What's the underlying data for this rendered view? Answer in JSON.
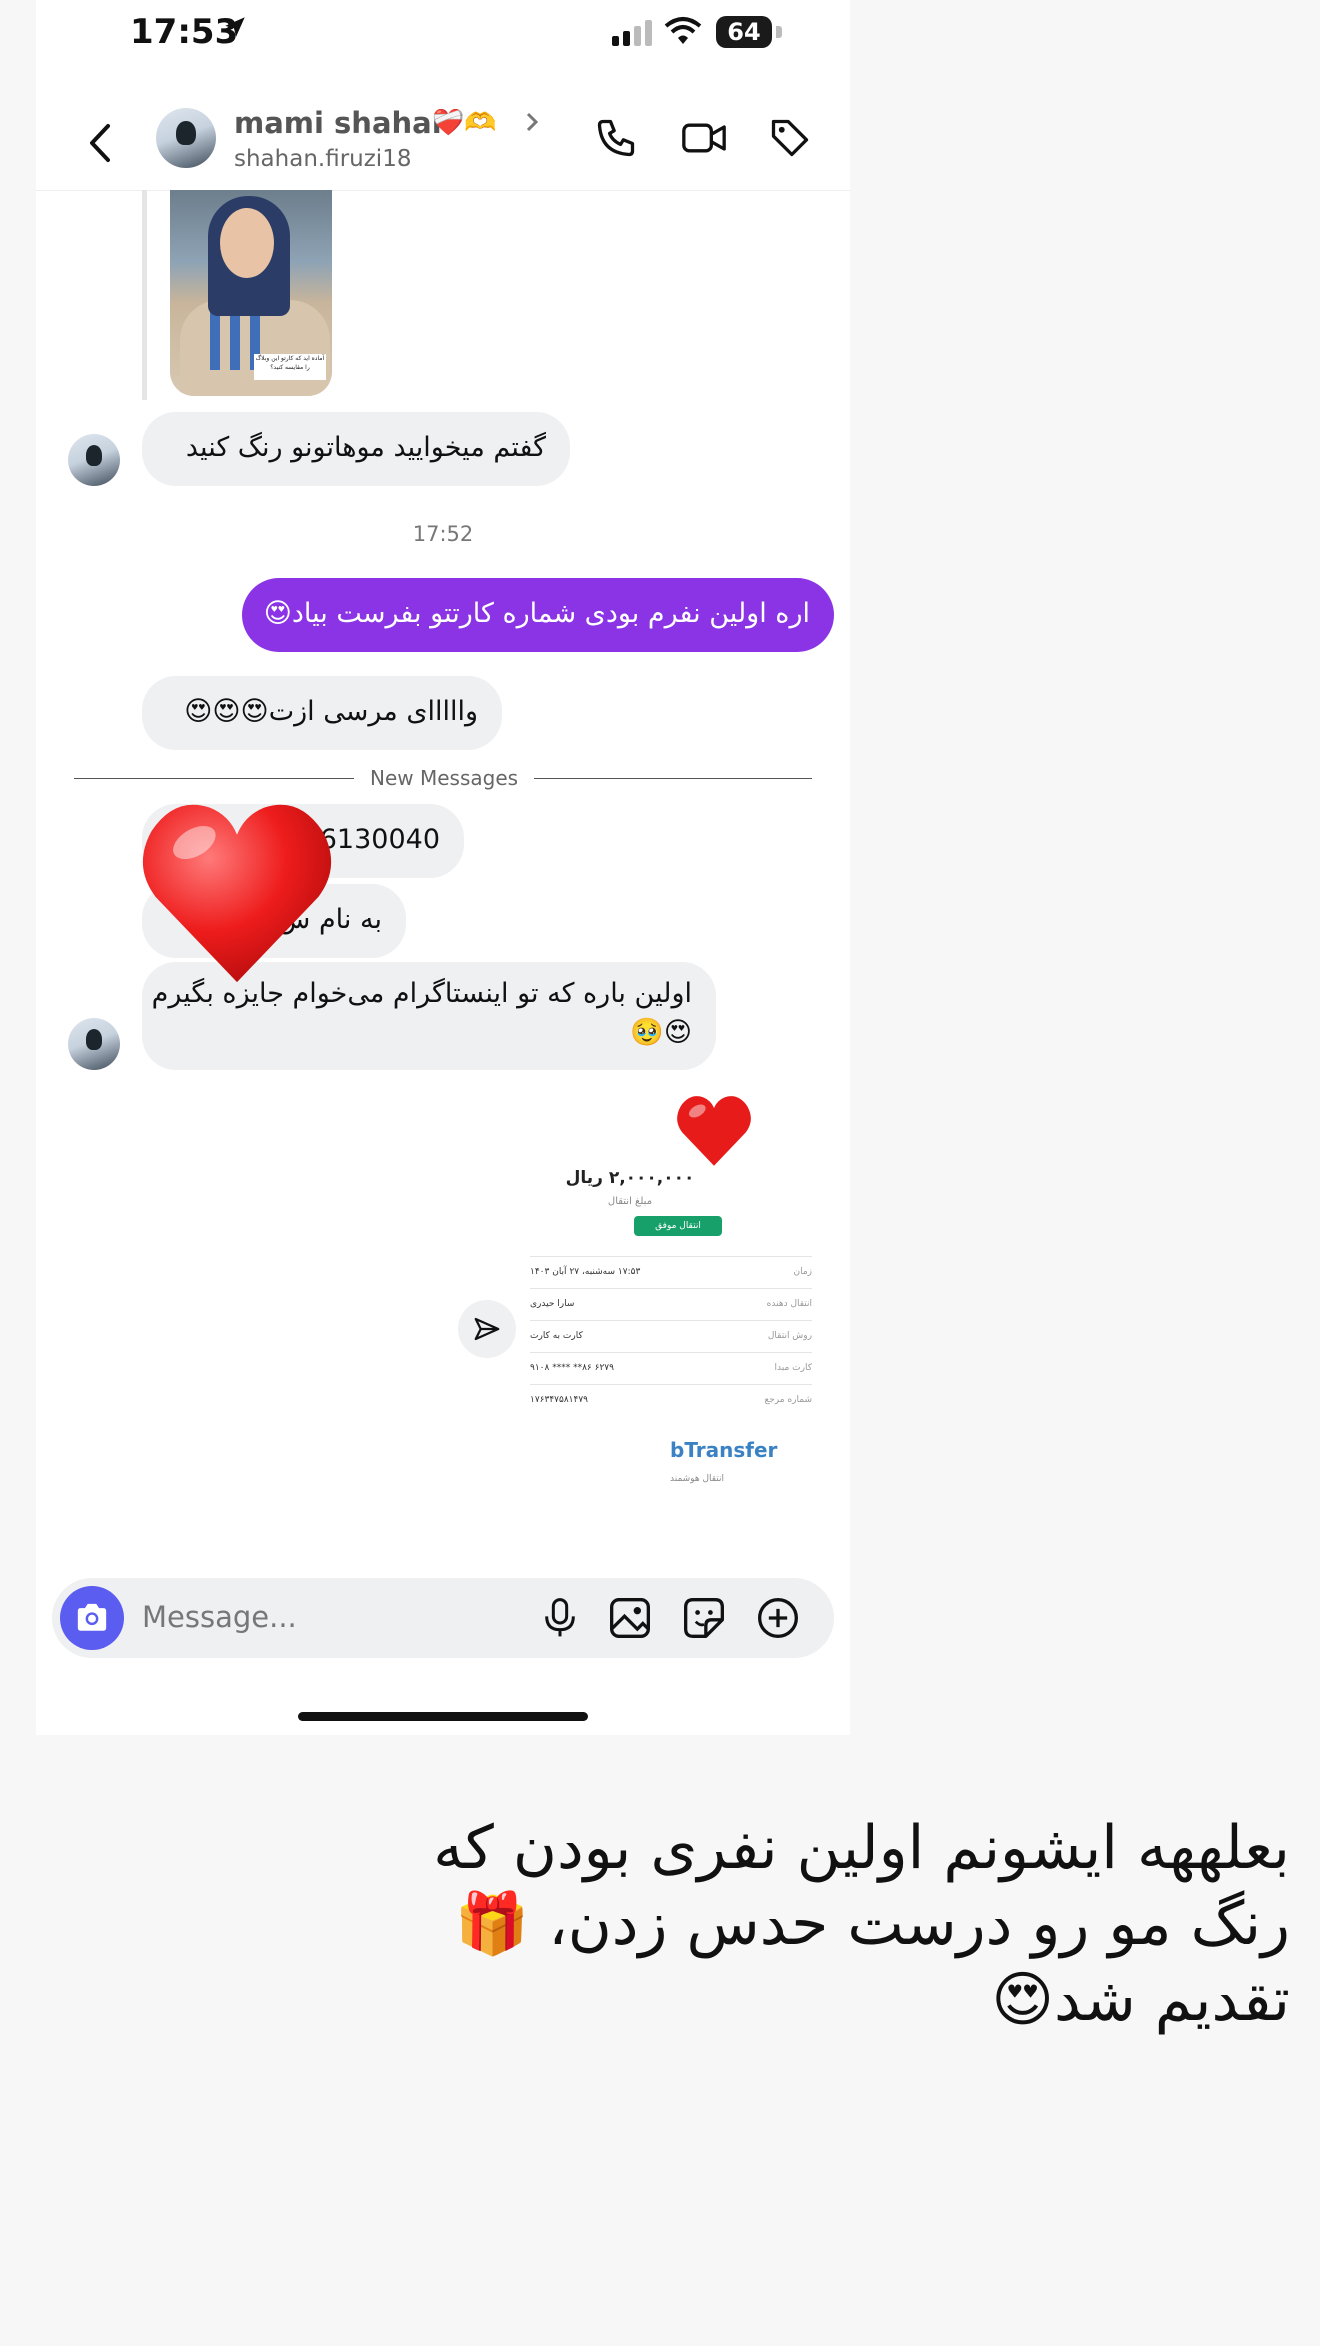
{
  "status_bar": {
    "time": "17:53",
    "battery": "64"
  },
  "header": {
    "name": "mami shahan",
    "name_emoji": "❤️‍🩹🫶",
    "username": "shahan.firuzi18",
    "icons": [
      "back-chevron-icon",
      "phone-icon",
      "video-icon",
      "tag-icon"
    ]
  },
  "shared_photo": {
    "caption": "آماده اید که کارتو این وبلاگ را مقایسه کنید؟"
  },
  "messages": [
    {
      "from": "them",
      "text": "گفتم میخوایید موهاتونو رنگ کنید"
    },
    {
      "timestamp": "17:52"
    },
    {
      "from": "me",
      "text": "اره اولین نفرم بودی شماره کارتتو بفرست بیاد😍"
    },
    {
      "from": "them",
      "text": "وااااای مرسی ازت😍😍😍"
    },
    {
      "divider": "New Messages"
    },
    {
      "from": "them",
      "text": "6130040"
    },
    {
      "from": "them",
      "text": "به نام س..."
    },
    {
      "from": "them",
      "text": "اولین باره که تو اینستاگرام می‌خوام جایزه بگیرم",
      "text2": "😍🥹"
    }
  ],
  "receipt": {
    "amount": "۲,۰۰۰,۰۰۰ ریال",
    "amount_label": "مبلغ انتقال",
    "status": "انتقال موفق",
    "rows": [
      {
        "key": "زمان",
        "value": "۱۷:۵۳ سه‌شنبه، ۲۷ آبان ۱۴۰۳"
      },
      {
        "key": "انتقال دهنده",
        "value": "سارا حیدری"
      },
      {
        "key": "روش انتقال",
        "value": "کارت به کارت"
      },
      {
        "key": "کارت مبدا",
        "value": "۶۲۷۹ ۸۶** **** ۹۱۰۸"
      },
      {
        "key": "شماره مرجع",
        "value": "۱۷۶۳۴۷۵۸۱۴۷۹"
      }
    ],
    "logo_main": "bTransfer",
    "logo_sub": "انتقال هوشمند"
  },
  "composer": {
    "placeholder": "Message..."
  },
  "story_caption": "بعلههه ایشونم اولین نفری بودن که رنگ مو رو درست حدس زدن، 🎁 تقدیم شد😍",
  "colors": {
    "sent_bubble": "#8a34e6",
    "received_bubble": "#eff0f2",
    "camera_button": "#5b5cf0"
  }
}
